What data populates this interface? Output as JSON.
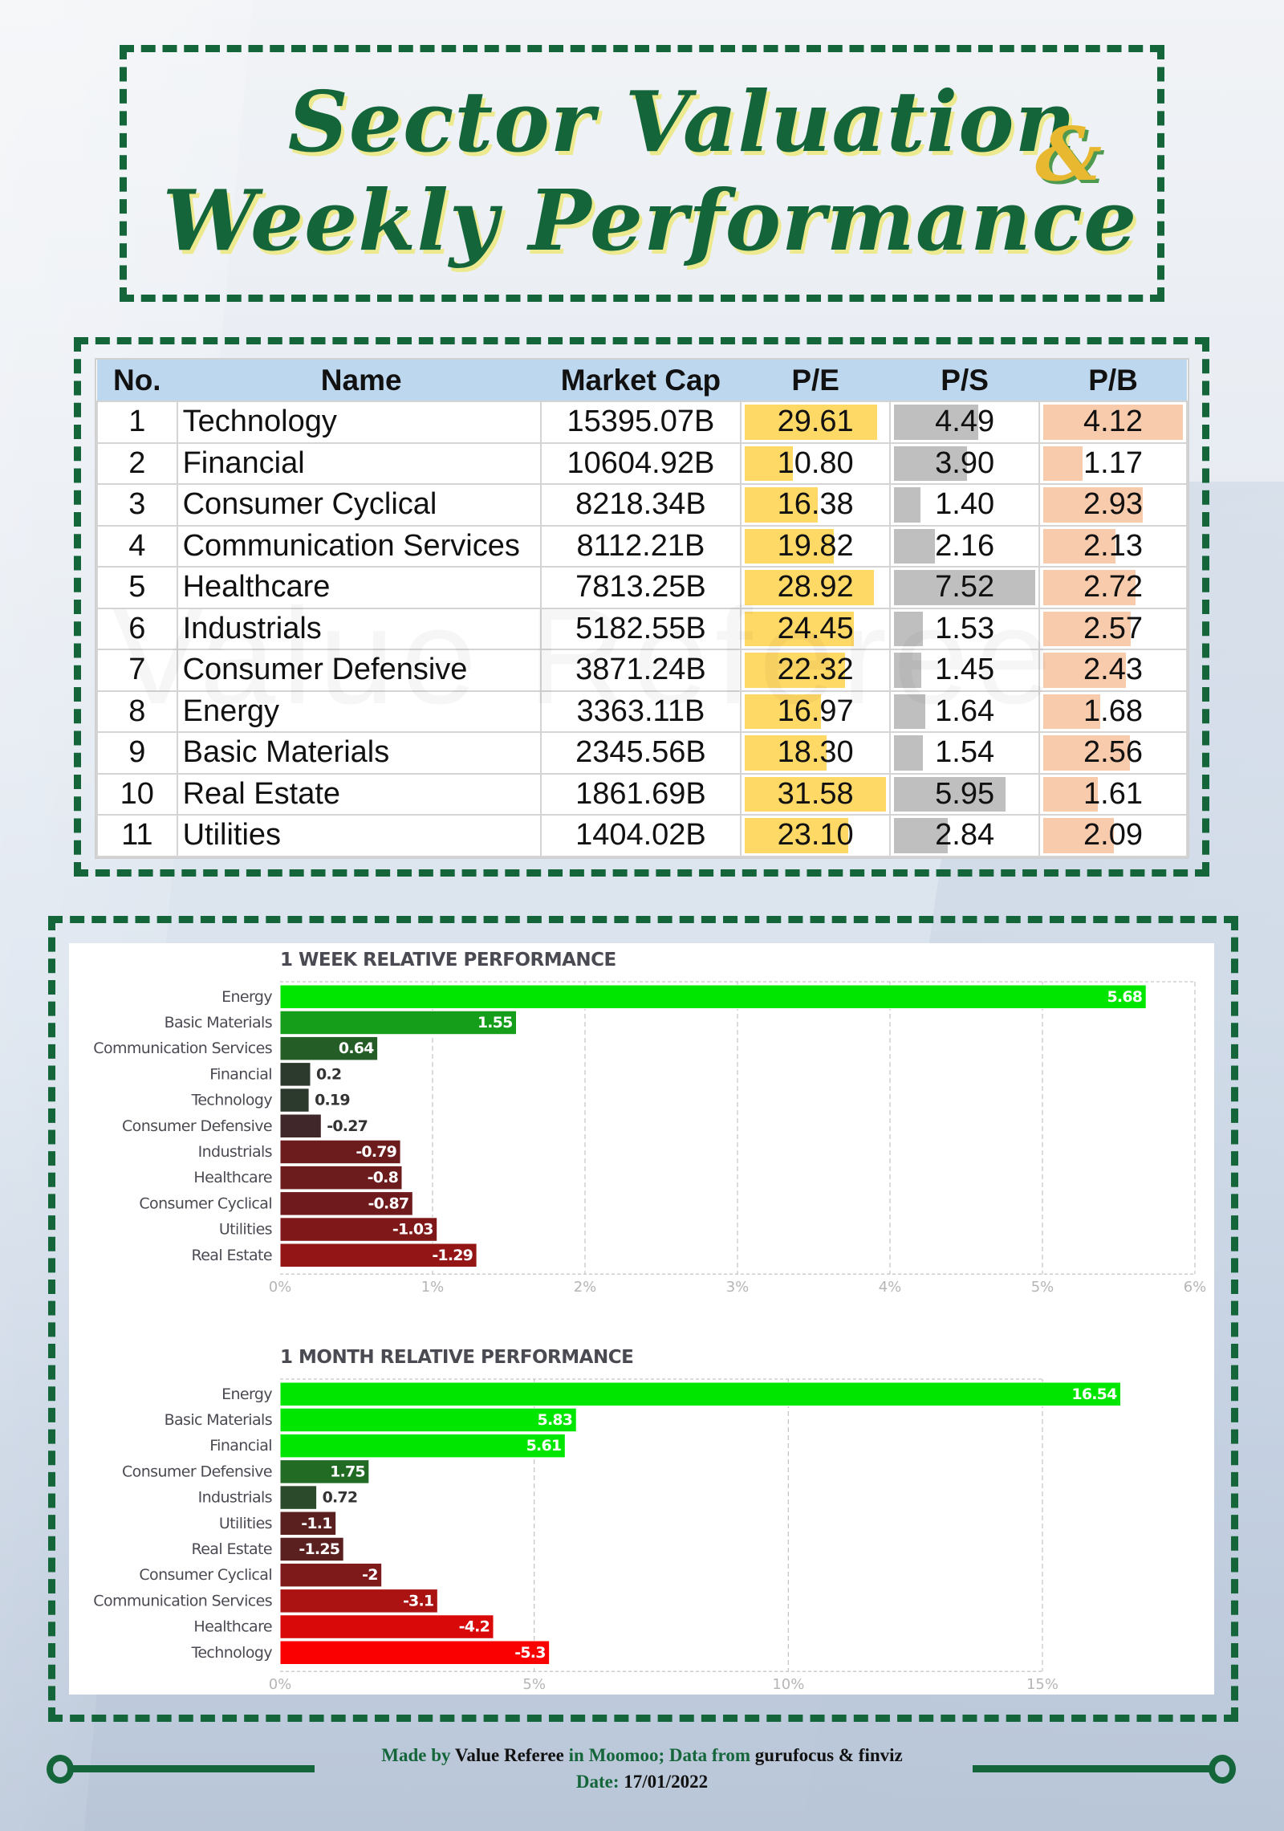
{
  "title": {
    "line1": "Sector Valuation",
    "ampersand": "&",
    "line2": "Weekly Performance"
  },
  "watermark": "Value Referee",
  "table": {
    "headers": [
      "No.",
      "Name",
      "Market Cap",
      "P/E",
      "P/S",
      "P/B"
    ],
    "bar_colors": {
      "pe": "#ffd966",
      "ps": "#bfbfbf",
      "pb": "#f8cbad"
    },
    "rows": [
      {
        "no": "1",
        "name": "Technology",
        "market_cap": "15395.07B",
        "pe": "29.61",
        "ps": "4.49",
        "pb": "4.12"
      },
      {
        "no": "2",
        "name": "Financial",
        "market_cap": "10604.92B",
        "pe": "10.80",
        "ps": "3.90",
        "pb": "1.17"
      },
      {
        "no": "3",
        "name": "Consumer Cyclical",
        "market_cap": "8218.34B",
        "pe": "16.38",
        "ps": "1.40",
        "pb": "2.93"
      },
      {
        "no": "4",
        "name": "Communication Services",
        "market_cap": "8112.21B",
        "pe": "19.82",
        "ps": "2.16",
        "pb": "2.13"
      },
      {
        "no": "5",
        "name": "Healthcare",
        "market_cap": "7813.25B",
        "pe": "28.92",
        "ps": "7.52",
        "pb": "2.72"
      },
      {
        "no": "6",
        "name": "Industrials",
        "market_cap": "5182.55B",
        "pe": "24.45",
        "ps": "1.53",
        "pb": "2.57"
      },
      {
        "no": "7",
        "name": "Consumer Defensive",
        "market_cap": "3871.24B",
        "pe": "22.32",
        "ps": "1.45",
        "pb": "2.43"
      },
      {
        "no": "8",
        "name": "Energy",
        "market_cap": "3363.11B",
        "pe": "16.97",
        "ps": "1.64",
        "pb": "1.68"
      },
      {
        "no": "9",
        "name": "Basic Materials",
        "market_cap": "2345.56B",
        "pe": "18.30",
        "ps": "1.54",
        "pb": "2.56"
      },
      {
        "no": "10",
        "name": "Real Estate",
        "market_cap": "1861.69B",
        "pe": "31.58",
        "ps": "5.95",
        "pb": "1.61"
      },
      {
        "no": "11",
        "name": "Utilities",
        "market_cap": "1404.02B",
        "pe": "23.10",
        "ps": "2.84",
        "pb": "2.09"
      }
    ]
  },
  "chart_data": [
    {
      "type": "bar",
      "orientation": "horizontal",
      "title": "1 WEEK RELATIVE PERFORMANCE",
      "xlabel": "",
      "ylabel": "",
      "xlim": [
        0,
        6
      ],
      "xticks": [
        "0%",
        "1%",
        "2%",
        "3%",
        "4%",
        "5%",
        "6%"
      ],
      "grid": true,
      "note": "bar length = absolute value; color encodes sign (green positive, red negative)",
      "categories": [
        "Energy",
        "Basic Materials",
        "Communication Services",
        "Financial",
        "Technology",
        "Consumer Defensive",
        "Industrials",
        "Healthcare",
        "Consumer Cyclical",
        "Utilities",
        "Real Estate"
      ],
      "values": [
        5.68,
        1.55,
        0.64,
        0.2,
        0.19,
        -0.27,
        -0.79,
        -0.8,
        -0.87,
        -1.03,
        -1.29
      ],
      "labels": [
        "5.68",
        "1.55",
        "0.64",
        "0.2",
        "0.19",
        "-0.27",
        "-0.79",
        "-0.8",
        "-0.87",
        "-1.03",
        "-1.29"
      ],
      "colors": [
        "#00e600",
        "#149e1a",
        "#245e26",
        "#2b3a2c",
        "#2b3a2c",
        "#40272a",
        "#6d1c1e",
        "#6d1c1e",
        "#6f1a1c",
        "#7f1818",
        "#941515"
      ]
    },
    {
      "type": "bar",
      "orientation": "horizontal",
      "title": "1 MONTH RELATIVE PERFORMANCE",
      "xlabel": "",
      "ylabel": "",
      "xlim": [
        0,
        15
      ],
      "xticks": [
        "0%",
        "5%",
        "10%",
        "15%"
      ],
      "grid": true,
      "note": "bar length = absolute value; color encodes sign (green positive, red negative)",
      "categories": [
        "Energy",
        "Basic Materials",
        "Financial",
        "Consumer Defensive",
        "Industrials",
        "Utilities",
        "Real Estate",
        "Consumer Cyclical",
        "Communication Services",
        "Healthcare",
        "Technology"
      ],
      "values": [
        16.54,
        5.83,
        5.61,
        1.75,
        0.72,
        -1.1,
        -1.25,
        -2,
        -3.1,
        -4.2,
        -5.3
      ],
      "labels": [
        "16.54",
        "5.83",
        "5.61",
        "1.75",
        "0.72",
        "-1.1",
        "-1.25",
        "-2",
        "-3.1",
        "-4.2",
        "-5.3"
      ],
      "colors": [
        "#00e600",
        "#00e600",
        "#00e600",
        "#226b25",
        "#2a4a2b",
        "#5a2020",
        "#5a2020",
        "#7e1a1a",
        "#ab1212",
        "#d90909",
        "#fa0000"
      ]
    }
  ],
  "footer": {
    "made_by_prefix": "Made by ",
    "author": "Value Referee",
    "platform_prefix": " in Moomoo; Data from ",
    "sources": "gurufocus & finviz",
    "date_label": "Date: ",
    "date": "17/01/2022"
  }
}
